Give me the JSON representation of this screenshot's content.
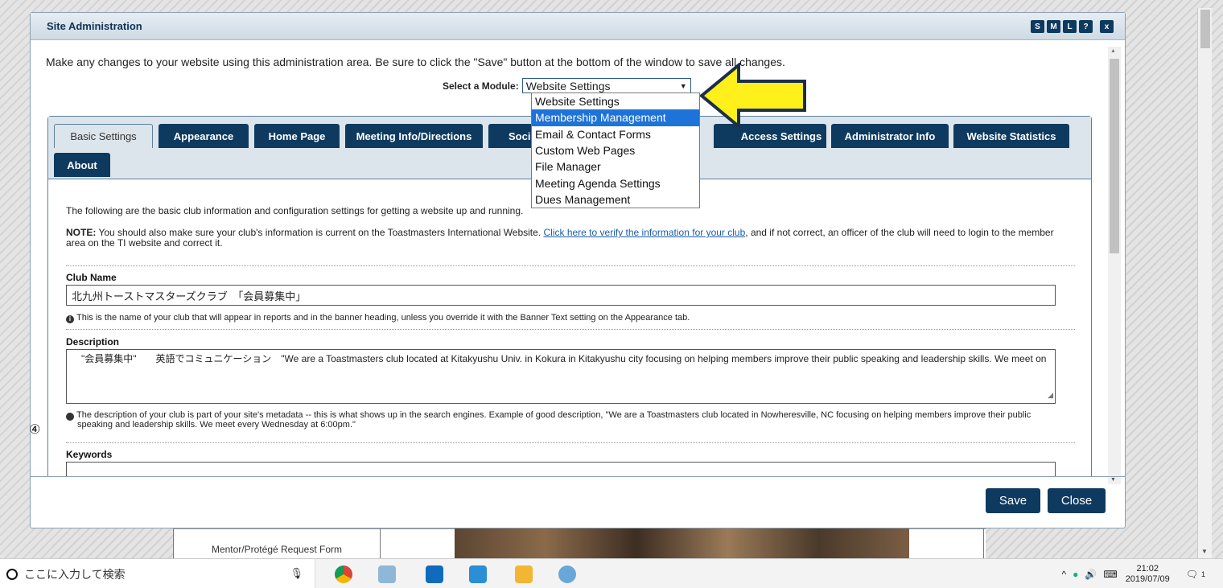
{
  "background": {
    "mentor_link": "Mentor/Protégé Request Form"
  },
  "modal": {
    "title": "Site Administration",
    "header_buttons": [
      "S",
      "M",
      "L",
      "?",
      "x"
    ],
    "intro": "Make any changes to your website using this administration area. Be sure to click the \"Save\" button at the bottom of the window to save all changes.",
    "module_label": "Select a Module:",
    "module_selected": "Website Settings",
    "module_options": [
      "Website Settings",
      "Membership Management",
      "Email & Contact Forms",
      "Custom Web Pages",
      "File Manager",
      "Meeting Agenda Settings",
      "Dues Management"
    ],
    "highlighted_option": "Membership Management",
    "tabs": [
      "Basic Settings",
      "Appearance",
      "Home Page",
      "Meeting Info/Directions",
      "Soci",
      "Access Settings",
      "Administrator Info",
      "Website Statistics",
      "About"
    ],
    "active_tab": "Basic Settings",
    "basic": {
      "lead": "The following are the basic club information and configuration settings for getting a website up and running.",
      "note_label": "NOTE:",
      "note_before": " You should also make sure your club's information is current on the Toastmasters International Website. ",
      "note_link": "Click here to verify the information for your club",
      "note_after": ", and if not correct, an officer of the club will need to login to the member area on the TI website and correct it.",
      "club_name_label": "Club Name",
      "club_name_value": "北九州トーストマスターズクラブ　「会員募集中」",
      "club_name_hint": "This is the name of your club that will appear in reports and in the banner heading, unless you override it with the Banner Text setting on the Appearance tab.",
      "description_label": "Description",
      "description_value": "　\"会員募集中\"　　英語でコミュニケーション　\"We are a Toastmasters club located at Kitakyushu Univ. in Kokura in Kitakyushu city focusing on helping members improve their public speaking and leadership skills. We meet on",
      "description_hint": "The description of your club is part of your site's metadata -- this is what shows up in the search engines. Example of good description, \"We are a Toastmasters club located in Nowheresville, NC focusing on helping members improve their public speaking and leadership skills. We meet every Wednesday at 6:00pm.\"",
      "keywords_label": "Keywords"
    },
    "annotation_marker": "④",
    "save_label": "Save",
    "close_label": "Close"
  },
  "taskbar": {
    "search_placeholder": "ここに入力して検索",
    "time": "21:02",
    "date": "2019/07/09",
    "notification_count": "1"
  },
  "colors": {
    "dark_navy": "#0f3a5f",
    "highlight_blue": "#1e73d8",
    "arrow_yellow": "#ffef1a"
  }
}
